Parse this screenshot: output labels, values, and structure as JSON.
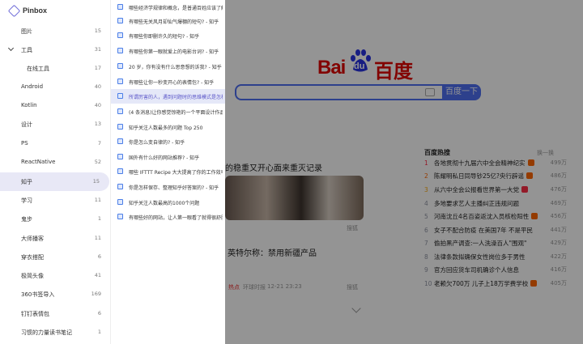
{
  "background_page": {
    "logo_bai": "Bai",
    "logo_du": "du",
    "logo_cn": "百度",
    "search_button": "百度一下",
    "news_headline": "的稳重又开心面来重灭记录",
    "news_source1": "搜狐",
    "news_title2": "英特尔称：禁用新疆产品",
    "news_meta": [
      "热点",
      "环球时报",
      "12-21 23:23"
    ],
    "news_source2": "搜狐",
    "hot_title": "百度热搜",
    "hot_refresh": "换一换",
    "hot_list": [
      {
        "rank": "1",
        "title": "各地贯彻十九届六中全会精神纪实",
        "value": "499万"
      },
      {
        "rank": "2",
        "title": "陈耀明私日同导钞25亿?央行辟谣",
        "value": "486万"
      },
      {
        "rank": "3",
        "title": "从六中全会公报看世界第一大党",
        "value": "476万"
      },
      {
        "rank": "4",
        "title": "多地要求艺人主播纠正违规问题",
        "value": "469万"
      },
      {
        "rank": "5",
        "title": "河南沈丘4名百姿返沈入员核检阳性",
        "value": "456万"
      },
      {
        "rank": "6",
        "title": "女子不配合防疫 在美国7年 不是平民",
        "value": "441万"
      },
      {
        "rank": "7",
        "title": "偷拍黑产调查:一人洗澡百人\"围观\"",
        "value": "429万"
      },
      {
        "rank": "8",
        "title": "法律条款拟确保女性岗位多于男性",
        "value": "422万"
      },
      {
        "rank": "9",
        "title": "官方回应货车司机确诊个人信息",
        "value": "416万"
      },
      {
        "rank": "10",
        "title": "老赖欠700万 儿子上18万学费学校",
        "value": "405万"
      }
    ]
  },
  "sidebar": {
    "app_name": "Pinbox",
    "categories": [
      {
        "label": "图片",
        "count": "15"
      },
      {
        "label": "工具",
        "count": "31"
      },
      {
        "label": "在线工具",
        "count": "17"
      },
      {
        "label": "Android",
        "count": "40"
      },
      {
        "label": "Kotlin",
        "count": "40"
      },
      {
        "label": "设计",
        "count": "13"
      },
      {
        "label": "PS",
        "count": "7"
      },
      {
        "label": "ReactNative",
        "count": "52"
      },
      {
        "label": "知乎",
        "count": "15"
      },
      {
        "label": "学习",
        "count": "11"
      },
      {
        "label": "鬼步",
        "count": "1"
      },
      {
        "label": "大师播客",
        "count": "11"
      },
      {
        "label": "穿衣搭配",
        "count": "6"
      },
      {
        "label": "极简头像",
        "count": "41"
      },
      {
        "label": "360书签导入",
        "count": "169"
      },
      {
        "label": "钉钉表情包",
        "count": "6"
      },
      {
        "label": "习惯的力量读书笔记",
        "count": "1"
      }
    ]
  },
  "bookmarks": [
    "哪些经济学规律和概念，是普通百姓应该了解的？",
    "有哪些无关风月却仙气爆棚的短句? - 知乎",
    "有哪些你即删许久的短句? - 知乎",
    "有哪些你第一眼就爱上的电影台词? - 知乎",
    "20 岁，你有没有什么思意想的诉我? - 知乎",
    "有哪些让你一秒变开心的表情包? - 知乎",
    "所谓厉害的人，遇到问题时的思维模式是怎样的？",
    "(4 条消息)让你感觉惊艳的一个平面设计作品",
    "知乎关注人数最多的问题 Top 250",
    "你是怎么变自律的? - 知乎",
    "国外有什么好的网站推荐? - 知乎",
    "哪些 IFTTT Recipe 大大提高了你的工作效率",
    "你是怎样保存、整理知乎好答案的? - 知乎",
    "知乎关注人数最高的1000个问题",
    "有哪些好的网站，让人第一眼看了就得很舒服"
  ]
}
